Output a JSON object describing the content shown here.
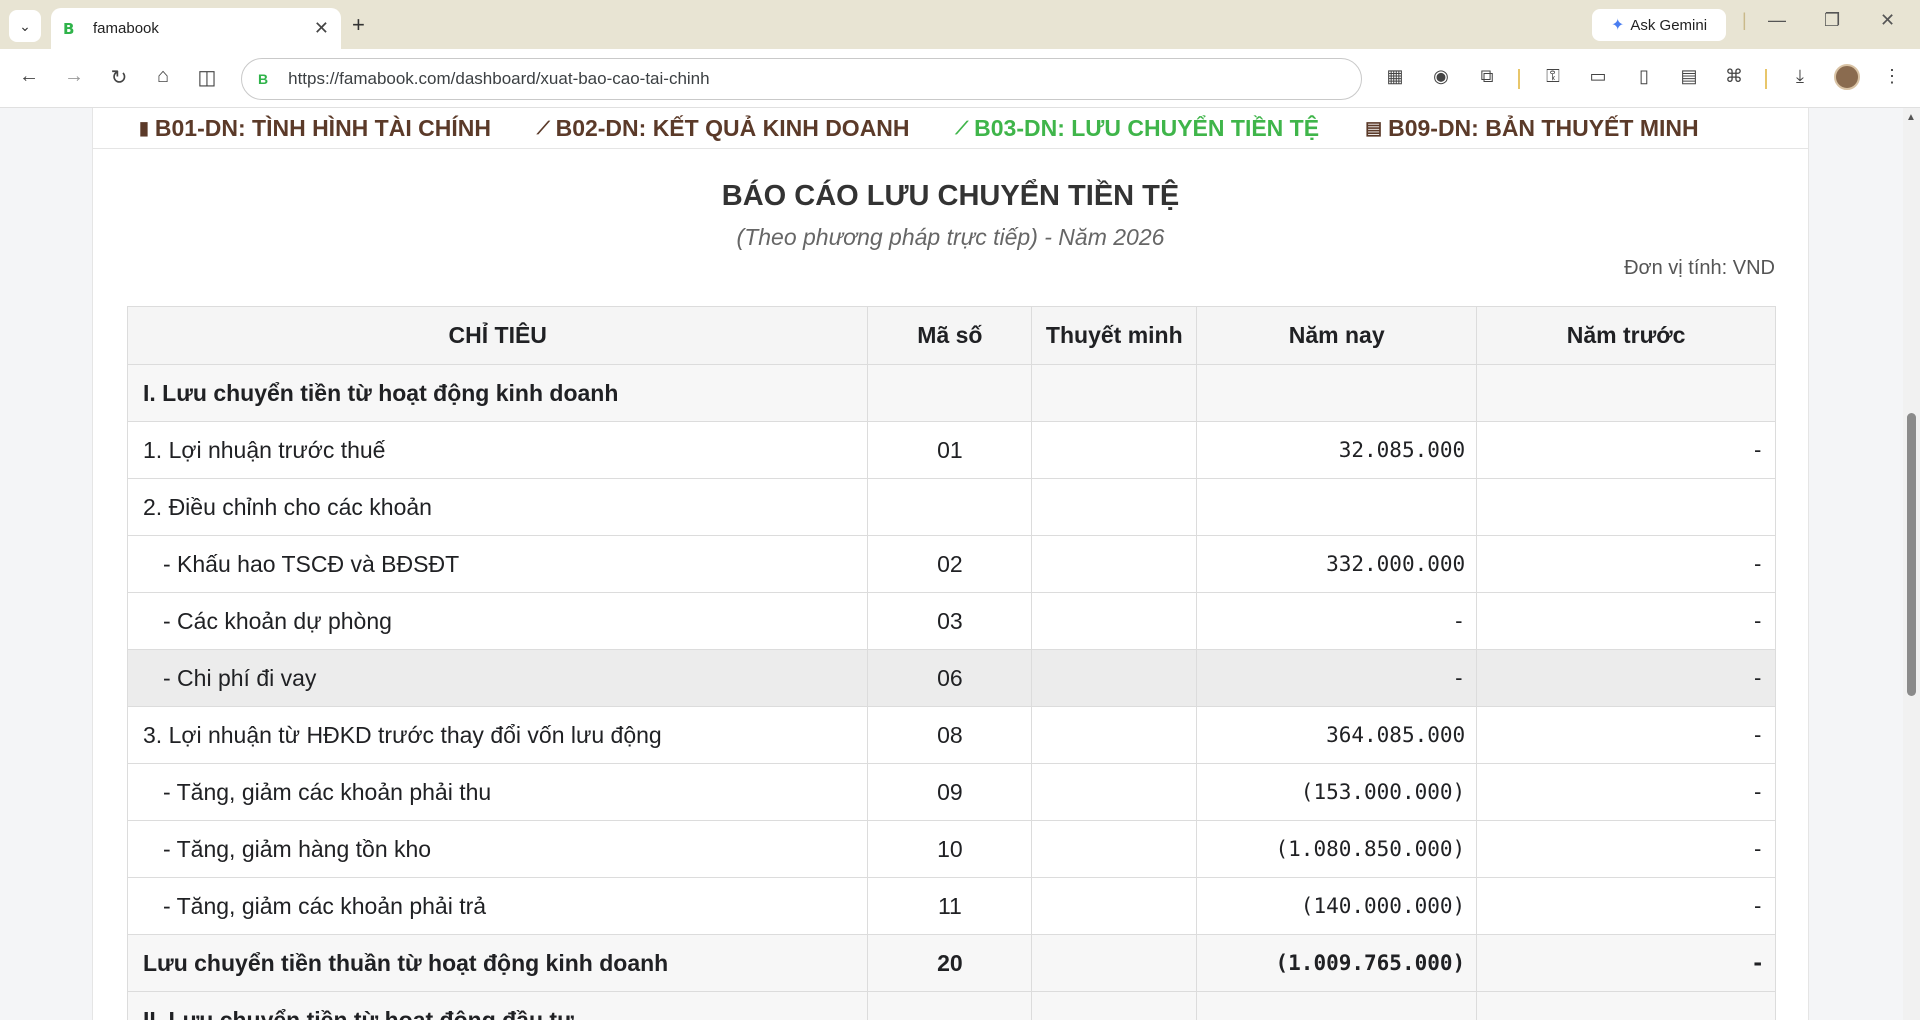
{
  "browser": {
    "tab_title": "famabook",
    "favicon": "B",
    "url": "https://famabook.com/dashboard/xuat-bao-cao-tai-chinh",
    "gemini_label": "Ask Gemini"
  },
  "report_tabs": [
    {
      "icon": "bar-chart-icon",
      "glyph": "▮",
      "label": "B01-DN: TÌNH HÌNH TÀI CHÍNH"
    },
    {
      "icon": "trend-line-icon",
      "glyph": "⟋",
      "label": "B02-DN: KẾT QUẢ KINH DOANH"
    },
    {
      "icon": "trend-line-icon",
      "glyph": "⟋",
      "label": "B03-DN: LƯU CHUYỂN TIỀN TỆ"
    },
    {
      "icon": "document-icon",
      "glyph": "▤",
      "label": "B09-DN: BẢN THUYẾT MINH"
    }
  ],
  "active_tab_color": "#3fb54a",
  "report": {
    "title": "BÁO CÁO LƯU CHUYỂN TIỀN TỆ",
    "subtitle": "(Theo phương pháp trực tiếp) - Năm 2026",
    "unit": "Đơn vị tính: VND",
    "headers": [
      "CHỈ TIÊU",
      "Mã số",
      "Thuyết minh",
      "Năm nay",
      "Năm trước"
    ],
    "rows": [
      {
        "name": "I. Lưu chuyển tiền từ hoạt động kinh doanh",
        "code": "",
        "note": "",
        "current": "",
        "previous": ""
      },
      {
        "name": "1. Lợi nhuận trước thuế",
        "code": "01",
        "note": "",
        "current": "32.085.000",
        "previous": "-"
      },
      {
        "name": "2. Điều chỉnh cho các khoản",
        "code": "",
        "note": "",
        "current": "",
        "previous": ""
      },
      {
        "name": "- Khấu hao TSCĐ và BĐSĐT",
        "code": "02",
        "note": "",
        "current": "332.000.000",
        "previous": "-"
      },
      {
        "name": "- Các khoản dự phòng",
        "code": "03",
        "note": "",
        "current": "-",
        "previous": "-"
      },
      {
        "name": "- Chi phí đi vay",
        "code": "06",
        "note": "",
        "current": "-",
        "previous": "-"
      },
      {
        "name": "3. Lợi nhuận từ HĐKD trước thay đổi vốn lưu động",
        "code": "08",
        "note": "",
        "current": "364.085.000",
        "previous": "-"
      },
      {
        "name": "- Tăng, giảm các khoản phải thu",
        "code": "09",
        "note": "",
        "current": "(153.000.000)",
        "previous": "-"
      },
      {
        "name": "- Tăng, giảm hàng tồn kho",
        "code": "10",
        "note": "",
        "current": "(1.080.850.000)",
        "previous": "-"
      },
      {
        "name": "- Tăng, giảm các khoản phải trả",
        "code": "11",
        "note": "",
        "current": "(140.000.000)",
        "previous": "-"
      },
      {
        "name": "Lưu chuyển tiền thuần từ hoạt động kinh doanh",
        "code": "20",
        "note": "",
        "current": "(1.009.765.000)",
        "previous": "-"
      },
      {
        "name": "II. Lưu chuyển tiền từ hoạt động đầu tư",
        "code": "",
        "note": "",
        "current": "",
        "previous": ""
      }
    ]
  }
}
